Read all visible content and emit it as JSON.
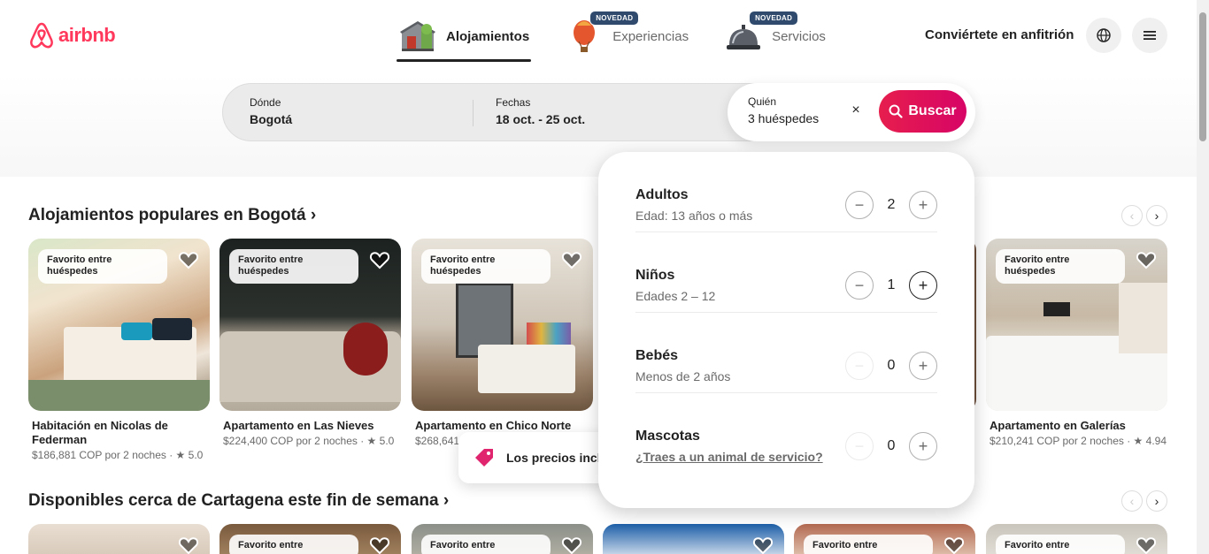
{
  "brand": {
    "name": "airbnb",
    "color": "#ff385c"
  },
  "nav": {
    "tabs": [
      {
        "label": "Alojamientos",
        "active": true,
        "icon": "house-icon"
      },
      {
        "label": "Experiencias",
        "badge": "NOVEDAD",
        "icon": "hot-air-balloon-icon"
      },
      {
        "label": "Servicios",
        "badge": "NOVEDAD",
        "icon": "service-bell-icon"
      }
    ],
    "host_link": "Conviértete en anfitrión"
  },
  "search": {
    "where_label": "Dónde",
    "where_value": "Bogotá",
    "dates_label": "Fechas",
    "dates_value": "18 oct. - 25 oct.",
    "who_label": "Quién",
    "who_value": "3 huéspedes",
    "clear": "×",
    "button": "Buscar"
  },
  "guests": [
    {
      "label": "Adultos",
      "desc": "Edad: 13 años o más",
      "value": "2"
    },
    {
      "label": "Niños",
      "desc": "Edades 2 – 12",
      "value": "1"
    },
    {
      "label": "Bebés",
      "desc": "Menos de 2 años",
      "value": "0"
    },
    {
      "label": "Mascotas",
      "desc": "¿Traes a un animal de servicio?",
      "value": "0"
    }
  ],
  "section1": {
    "title": "Alojamientos populares en Bogotá ›",
    "cards": [
      {
        "badge": "Favorito entre huéspedes",
        "title": "Habitación en Nicolas de Federman",
        "sub": "$186,881 COP por 2 noches · ★ 5.0"
      },
      {
        "badge": "Favorito entre huéspedes",
        "title": "Apartamento en Las Nieves",
        "sub": "$224,400 COP por 2 noches · ★ 5.0"
      },
      {
        "badge": "Favorito entre huéspedes",
        "title": "Apartamento en Chico Norte",
        "sub": "$268,641"
      },
      {
        "badge": "Favorito entre huéspedes",
        "title": "Apartamento en Galerías",
        "sub": "$210,241 COP por 2 noches · ★ 4.94"
      }
    ]
  },
  "section2": {
    "title": "Disponibles cerca de Cartagena este fin de semana ›",
    "badge": "Favorito entre"
  },
  "toast": {
    "text": "Los precios inclu"
  }
}
